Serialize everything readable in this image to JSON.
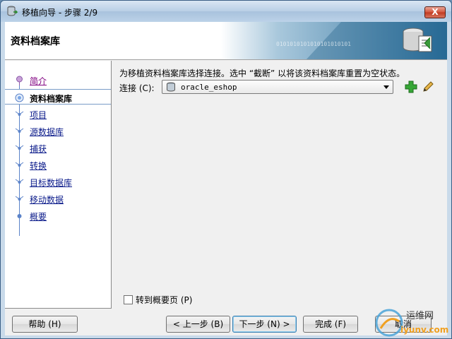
{
  "window": {
    "title": "移植向导 - 步骤 2/9",
    "close_label": "X"
  },
  "banner": {
    "title": "资料档案库",
    "art_text": "0101010101010101010101"
  },
  "steps": [
    {
      "label": "简介",
      "state": "done"
    },
    {
      "label": "资料档案库",
      "state": "active"
    },
    {
      "label": "项目",
      "state": "pending"
    },
    {
      "label": "源数据库",
      "state": "pending"
    },
    {
      "label": "捕获 ",
      "state": "pending"
    },
    {
      "label": "转换",
      "state": "pending"
    },
    {
      "label": "目标数据库",
      "state": "pending"
    },
    {
      "label": "移动数据",
      "state": "pending"
    },
    {
      "label": "概要",
      "state": "pending"
    }
  ],
  "content": {
    "instruction": "为移植资料档案库选择连接。选中 “截断” 以将该资料档案库重置为空状态。",
    "connection_label": "连接 (C):",
    "connection_value": "oracle_eshop",
    "add_icon": "add-connection-icon",
    "edit_icon": "edit-pencil-icon",
    "skip_label": "转到概要页 (P)"
  },
  "footer": {
    "help": "帮助 (H)",
    "back": "< 上一步 (B)",
    "next": "下一步 (N) >",
    "finish": "完成 (F)",
    "cancel": "取消"
  },
  "watermark": {
    "line1": "运维网",
    "line2": "iyunv.com"
  },
  "colors": {
    "title_bar": "#b9cfe6",
    "close_button": "#c0391f",
    "step_link": "#0a1a8a",
    "step_visited": "#800080",
    "banner_art": "#2b6f9c"
  }
}
